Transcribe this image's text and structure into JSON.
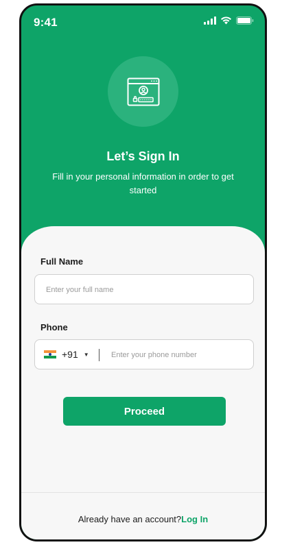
{
  "status_bar": {
    "time": "9:41"
  },
  "hero": {
    "icon": "login-window-icon",
    "title": "Let’s Sign In",
    "subtitle": "Fill in your personal information in order to get started"
  },
  "form": {
    "full_name": {
      "label": "Full Name",
      "placeholder": "Enter your full name",
      "value": ""
    },
    "phone": {
      "label": "Phone",
      "country_flag": "india-flag-icon",
      "dial_code": "+91",
      "placeholder": "Enter your phone number",
      "value": ""
    },
    "proceed_label": "Proceed"
  },
  "footer": {
    "prompt": "Already have an account?",
    "link": "Log In"
  },
  "colors": {
    "brand_green": "#0ea468",
    "card_background": "#f7f7f7"
  }
}
